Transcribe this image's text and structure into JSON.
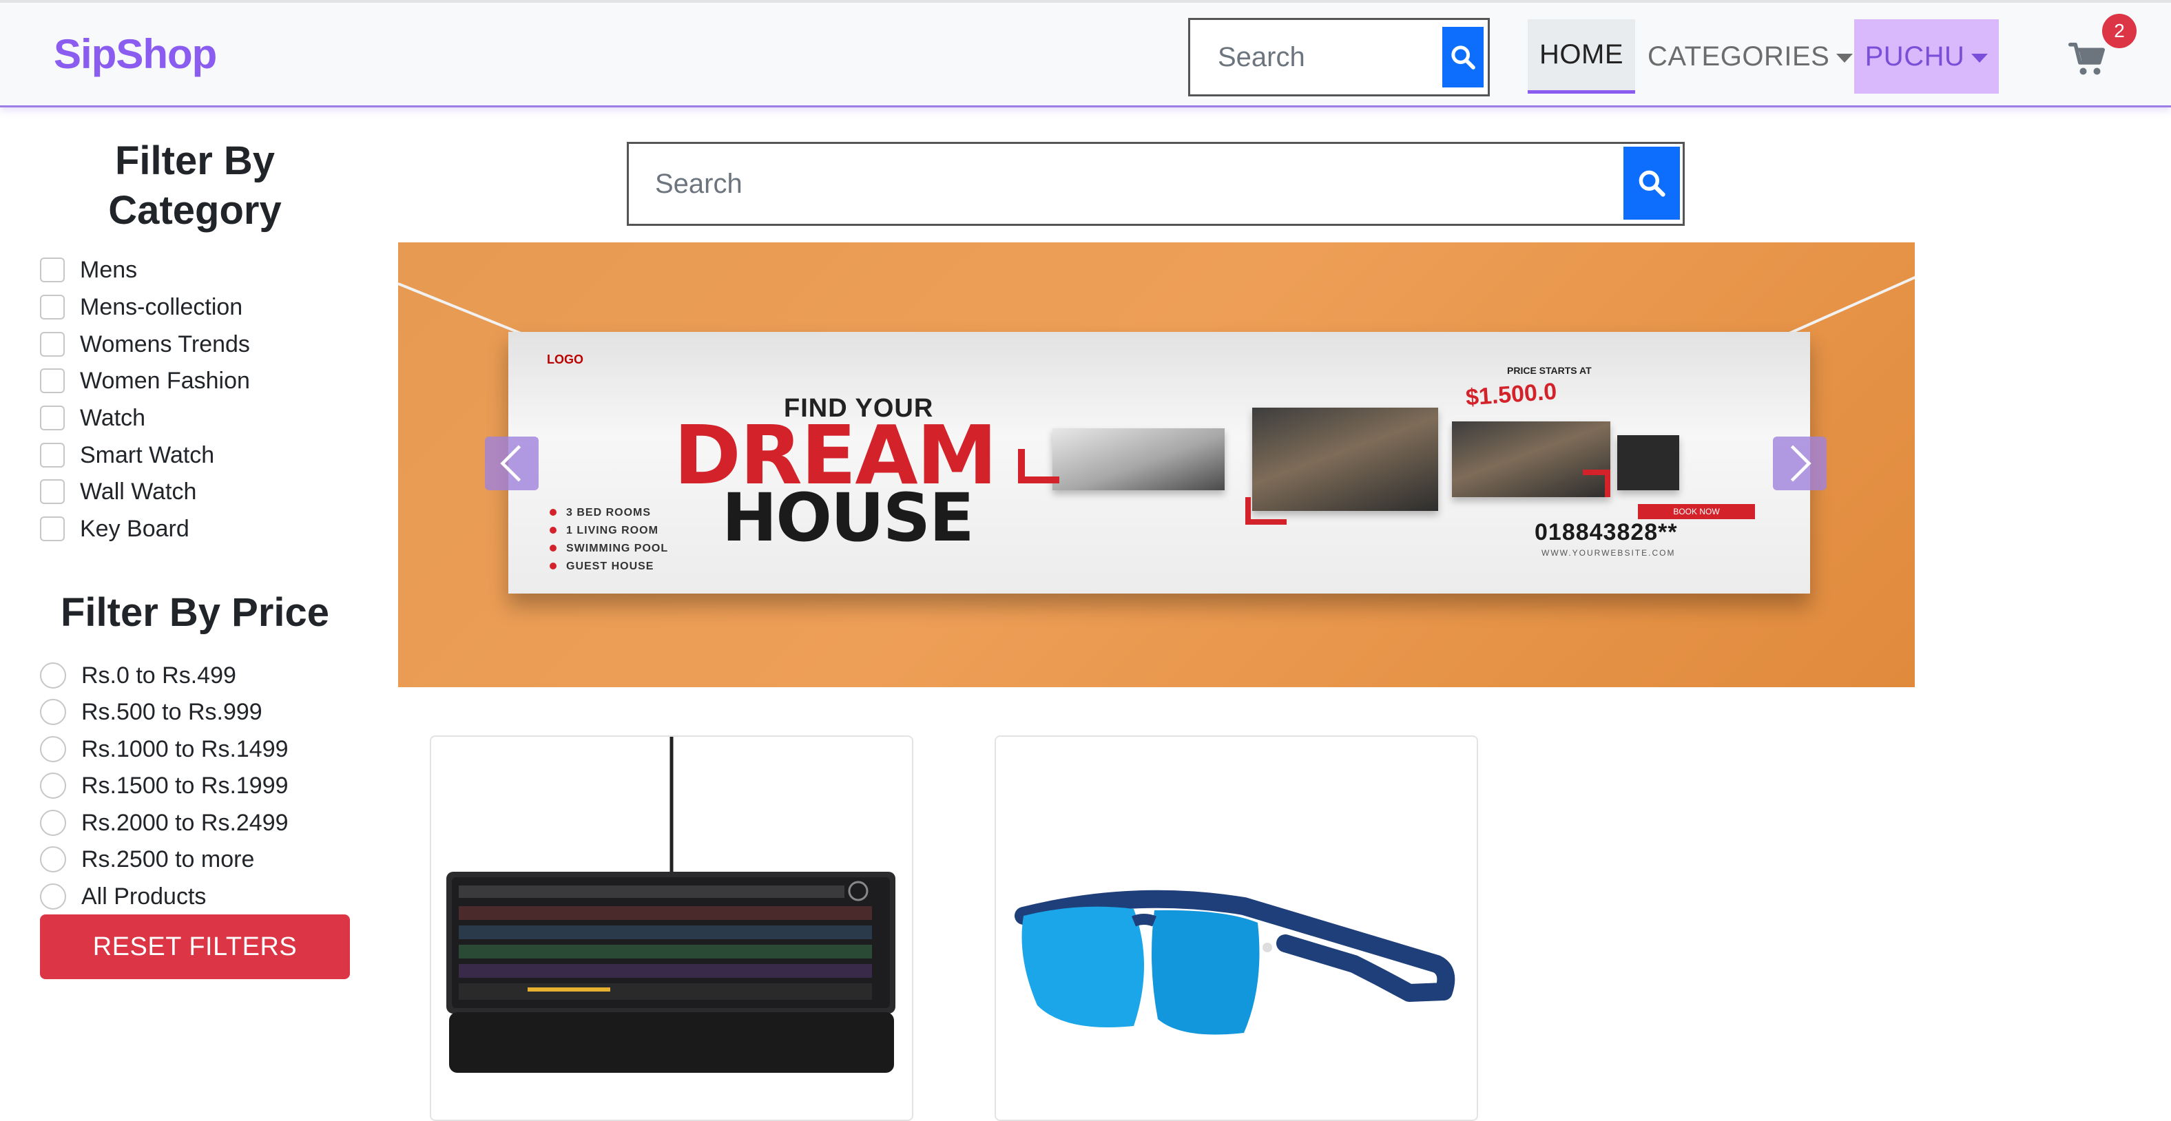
{
  "brand": "SipShop",
  "nav": {
    "search_placeholder": "Search",
    "home": "HOME",
    "categories": "CATEGORIES",
    "user": "PUCHU",
    "cart_count": "2"
  },
  "sidebar": {
    "category_title": "Filter By Category",
    "categories": [
      "Mens",
      "Mens-collection",
      "Womens Trends",
      "Women Fashion",
      "Watch",
      "Smart Watch",
      "Wall Watch",
      "Key Board"
    ],
    "price_title": "Filter By Price",
    "prices": [
      "Rs.0 to Rs.499",
      "Rs.500 to Rs.999",
      "Rs.1000 to Rs.1499",
      "Rs.1500 to Rs.1999",
      "Rs.2000 to Rs.2499",
      "Rs.2500 to more",
      "All Products"
    ],
    "reset": "RESET FILTERS"
  },
  "main": {
    "search_placeholder": "Search"
  },
  "banner": {
    "find": "FIND YOUR",
    "dream": "DREAM",
    "house": "HOUSE",
    "features": [
      "3 BED ROOMS",
      "1 LIVING ROOM",
      "SWIMMING POOL",
      "GUEST HOUSE"
    ],
    "price_caption": "PRICE STARTS AT",
    "price": "$1.500.0",
    "book": "BOOK NOW",
    "phone": "018843828**",
    "website": "WWW.YOURWEBSITE.COM",
    "logo": "LOGO"
  },
  "colors": {
    "brand": "#8a5cf0",
    "primary": "#0d6efd",
    "danger": "#dc3545",
    "user_bg": "#d9b8fb"
  },
  "icons": {
    "search": "search-icon",
    "cart": "cart-icon",
    "prev": "chevron-left-icon",
    "next": "chevron-right-icon"
  }
}
